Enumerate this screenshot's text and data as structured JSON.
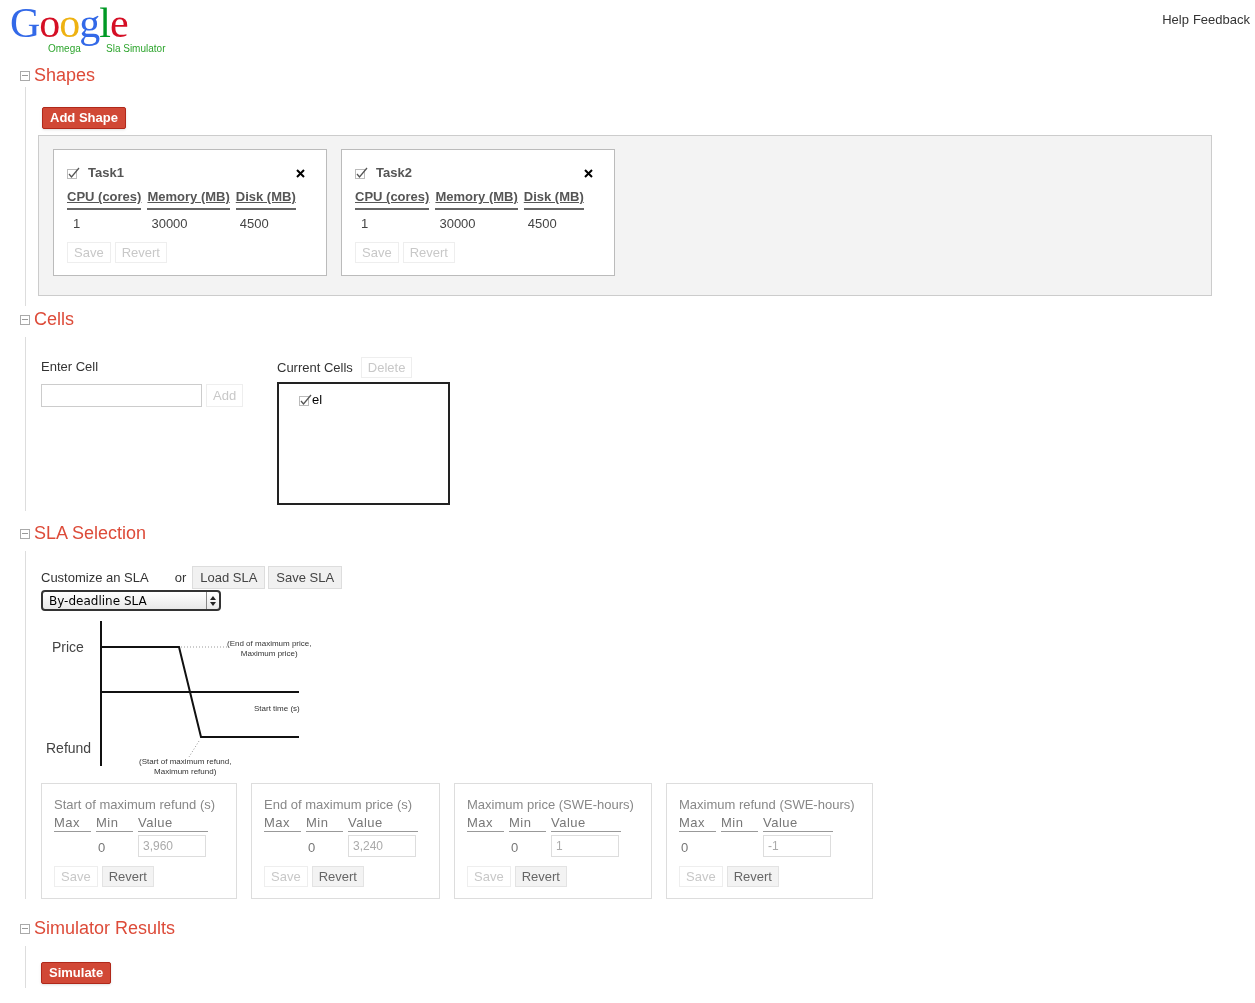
{
  "logo": {
    "wordmark": "Google",
    "left_tag": "Omega",
    "right_tag": "Sla Simulator"
  },
  "top_links": [
    "Help",
    "Feedback"
  ],
  "shapes": {
    "title": "Shapes",
    "expanded": true,
    "add_button": "Add Shape",
    "tasks": [
      {
        "name": "Task1",
        "checked": true,
        "columns": [
          "CPU (cores)",
          "Memory (MB)",
          "Disk (MB)"
        ],
        "values": [
          "1",
          "30000",
          "4500"
        ],
        "buttons": [
          {
            "label": "Save",
            "disabled": true
          },
          {
            "label": "Revert",
            "disabled": true
          }
        ]
      },
      {
        "name": "Task2",
        "checked": true,
        "columns": [
          "CPU (cores)",
          "Memory (MB)",
          "Disk (MB)"
        ],
        "values": [
          "1",
          "30000",
          "4500"
        ],
        "buttons": [
          {
            "label": "Save",
            "disabled": true
          },
          {
            "label": "Revert",
            "disabled": true
          }
        ]
      }
    ]
  },
  "cells": {
    "title": "Cells",
    "expanded": true,
    "enter_label": "Enter Cell",
    "add_button": {
      "label": "Add",
      "disabled": true
    },
    "current_label": "Current Cells",
    "delete_button": {
      "label": "Delete",
      "disabled": true
    },
    "items": [
      {
        "label": "el",
        "checked": true
      }
    ]
  },
  "sla": {
    "title": "SLA Selection",
    "expanded": true,
    "customize_label": "Customize an SLA",
    "or": "or",
    "load_button": "Load SLA",
    "save_button": "Save SLA",
    "select_value": "By-deadline SLA",
    "diagram": {
      "price": "Price",
      "refund": "Refund",
      "end_note": [
        "(End of maximum price,",
        "Maximum price)"
      ],
      "time_note": "Start time (s)",
      "start_note": [
        "(Start of maximum refund,",
        "Maximum refund)"
      ]
    },
    "params": [
      {
        "title": "Start of maximum refund (s)",
        "columns": [
          "Max",
          "Min",
          "Value"
        ],
        "min": "0",
        "value": "3,960",
        "buttons": [
          {
            "label": "Save",
            "disabled": true
          },
          {
            "label": "Revert",
            "disabled": false
          }
        ]
      },
      {
        "title": "End of maximum price (s)",
        "columns": [
          "Max",
          "Min",
          "Value"
        ],
        "min": "0",
        "value": "3,240",
        "buttons": [
          {
            "label": "Save",
            "disabled": true
          },
          {
            "label": "Revert",
            "disabled": false
          }
        ]
      },
      {
        "title": "Maximum price (SWE-hours)",
        "columns": [
          "Max",
          "Min",
          "Value"
        ],
        "min": "0",
        "value": "1",
        "buttons": [
          {
            "label": "Save",
            "disabled": true
          },
          {
            "label": "Revert",
            "disabled": false
          }
        ]
      },
      {
        "title": "Maximum refund (SWE-hours)",
        "columns": [
          "Max",
          "Min",
          "Value"
        ],
        "max": "0",
        "value": "-1",
        "buttons": [
          {
            "label": "Save",
            "disabled": true
          },
          {
            "label": "Revert",
            "disabled": false
          }
        ]
      }
    ]
  },
  "results": {
    "title": "Simulator Results",
    "expanded": true,
    "simulate_button": "Simulate"
  }
}
